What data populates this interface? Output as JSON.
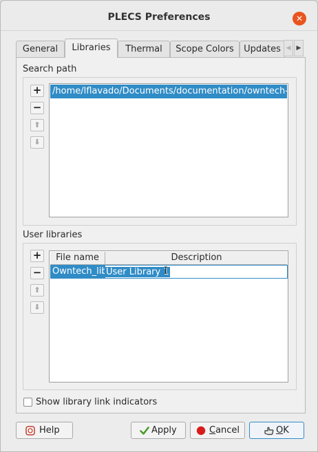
{
  "window": {
    "title": "PLECS Preferences",
    "close_glyph": "✕"
  },
  "tabs": [
    {
      "label": "General",
      "active": false
    },
    {
      "label": "Libraries",
      "active": true
    },
    {
      "label": "Thermal",
      "active": false
    },
    {
      "label": "Scope Colors",
      "active": false
    },
    {
      "label": "Updates",
      "active": false
    }
  ],
  "tab_scroll": {
    "left_icon": "◀",
    "right_icon": "▶"
  },
  "search_path": {
    "label": "Search path",
    "items": [
      "/home/lflavado/Documents/documentation/owntech-..."
    ],
    "buttons": {
      "add": "+",
      "remove": "−",
      "up": "⬆",
      "down": "⬇"
    }
  },
  "user_libraries": {
    "label": "User libraries",
    "columns": [
      "File name",
      "Description"
    ],
    "rows": [
      {
        "file_name": "Owntech_lib",
        "description": "User Library 1"
      }
    ],
    "buttons": {
      "add": "+",
      "remove": "−",
      "up": "⬆",
      "down": "⬇"
    },
    "cursor_glyph": "I"
  },
  "options": {
    "show_link_indicators_label": "Show library link indicators",
    "show_link_indicators_checked": false
  },
  "footer": {
    "help_label": "Help",
    "apply_label": "Apply",
    "cancel_label": "Cancel",
    "ok_label": "OK"
  },
  "colors": {
    "selection": "#308cc6",
    "close": "#e95420",
    "apply_check": "#4a9a2a",
    "cancel_dot": "#d81b1b"
  }
}
